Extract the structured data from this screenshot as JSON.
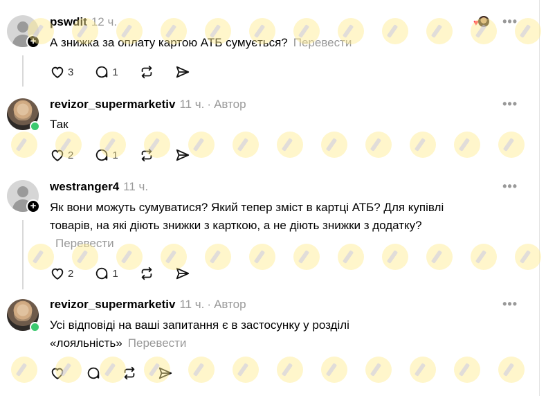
{
  "posts": [
    {
      "username": "pswdit",
      "time": "12 ч.",
      "author_label": "",
      "text": "А знижка за оплату картою АТБ сумується?",
      "translate": "Перевести",
      "likes": "3",
      "replies": "1",
      "avatar": "default-avatar",
      "badge": "follow-plus"
    },
    {
      "username": "revizor_supermarketiv",
      "time": "11 ч.",
      "author_label": "Автор",
      "text": "Так",
      "translate": "",
      "likes": "2",
      "replies": "1",
      "avatar": "photo-avatar",
      "badge": "online"
    },
    {
      "username": "westranger4",
      "time": "11 ч.",
      "author_label": "",
      "text": "Як вони можуть сумуватися? Який тепер зміст в картці АТБ? Для купівлі товарів, на які діють знижки з карткою, а не діють знижки з додатку?",
      "translate": "Перевести",
      "likes": "2",
      "replies": "1",
      "avatar": "default-avatar",
      "badge": "follow-plus"
    },
    {
      "username": "revizor_supermarketiv",
      "time": "11 ч.",
      "author_label": "Автор",
      "text": "Усі відповіді на ваші запитання є в застосунку у розділі «лояльність»",
      "translate": "Перевести",
      "likes": "",
      "replies": "",
      "avatar": "photo-avatar",
      "badge": "online"
    }
  ],
  "separator": "·",
  "more_label": "•••",
  "colors": {
    "muted": "#999999",
    "online": "#3cc96f",
    "like_heart": "#ff2a55",
    "watermark": "#ffec8c"
  }
}
